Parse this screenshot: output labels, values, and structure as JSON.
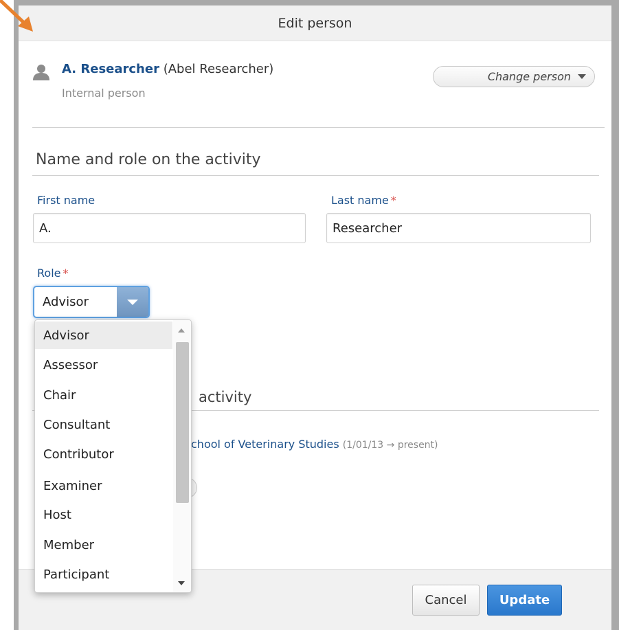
{
  "dialog": {
    "title": "Edit person"
  },
  "person": {
    "short_name": "A. Researcher",
    "full_name": "(Abel Researcher)",
    "type": "Internal person",
    "change_label": "Change person"
  },
  "form": {
    "section_title": "Name and role on the activity",
    "first_name_label": "First name",
    "first_name_value": "A.",
    "last_name_label": "Last name",
    "last_name_value": "Researcher",
    "required_mark": "*",
    "role_label": "Role",
    "role_value": "Advisor"
  },
  "role_options": [
    "Advisor",
    "Assessor",
    "Chair",
    "Consultant",
    "Contributor",
    "Examiner",
    "Host",
    "Member",
    "Participant"
  ],
  "background": {
    "section_partial": "activity",
    "affiliation_partial": "chool of Veterinary Studies",
    "affiliation_dates": "(1/01/13 → present)"
  },
  "buttons": {
    "cancel": "Cancel",
    "update": "Update"
  },
  "colors": {
    "link": "#1a4f8a",
    "primary": "#2a78cc",
    "required": "#d9534f",
    "annotation_arrow": "#e8822e"
  },
  "icons": {
    "person": "person-icon",
    "change_caret": "chevron-down-icon",
    "select_caret": "chevron-down-icon",
    "annotation": "arrow-icon"
  }
}
